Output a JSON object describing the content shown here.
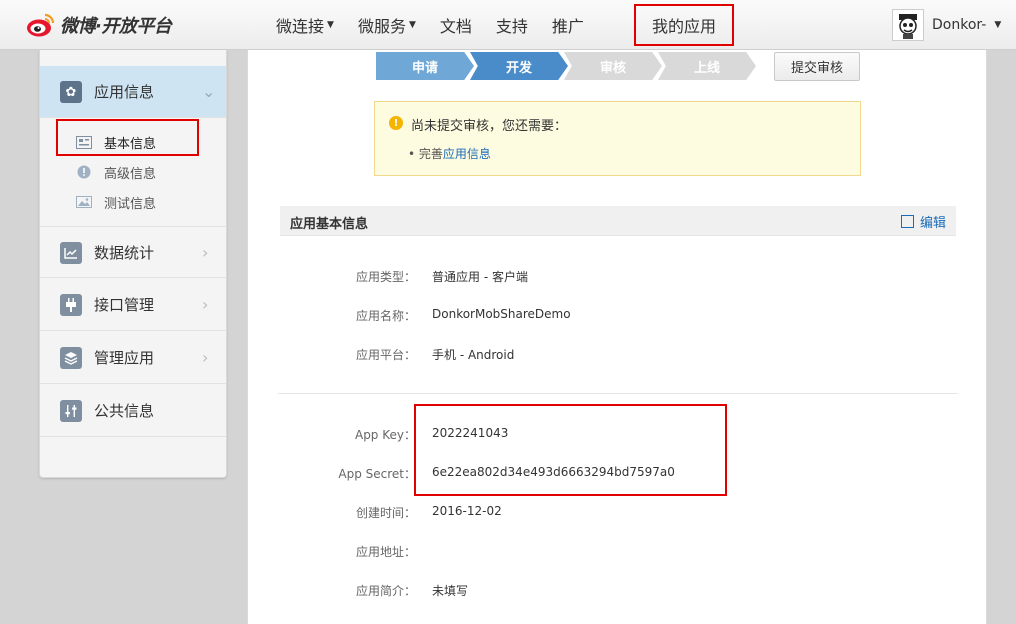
{
  "header": {
    "logo_text": "微博·开放平台",
    "nav": [
      {
        "label": "微连接",
        "caret": true
      },
      {
        "label": "微服务",
        "caret": true
      },
      {
        "label": "文档",
        "caret": false
      },
      {
        "label": "支持",
        "caret": false
      },
      {
        "label": "推广",
        "caret": false
      }
    ],
    "my_apps": "我的应用",
    "user_name": "Donkor-"
  },
  "sidebar": {
    "groups": [
      {
        "label": "应用信息",
        "icon": "gear-icon",
        "active": true
      },
      {
        "label": "数据统计",
        "icon": "chart-icon"
      },
      {
        "label": "接口管理",
        "icon": "plug-icon"
      },
      {
        "label": "管理应用",
        "icon": "layers-icon"
      },
      {
        "label": "公共信息",
        "icon": "sliders-icon"
      }
    ],
    "sub_items": [
      {
        "label": "基本信息",
        "icon": "card-icon",
        "current": true
      },
      {
        "label": "高级信息",
        "icon": "alert-icon"
      },
      {
        "label": "测试信息",
        "icon": "image-icon"
      }
    ]
  },
  "steps": [
    {
      "label": "申请",
      "state": "done"
    },
    {
      "label": "开发",
      "state": "current"
    },
    {
      "label": "审核",
      "state": "todo"
    },
    {
      "label": "上线",
      "state": "todo"
    }
  ],
  "submit_button": "提交审核",
  "notice": {
    "title": "尚未提交审核，您还需要：",
    "item_prefix": "完善",
    "item_link": "应用信息"
  },
  "section": {
    "title": "应用基本信息",
    "edit": "编辑"
  },
  "fields": [
    {
      "key": "应用类型：",
      "value": "普通应用 - 客户端"
    },
    {
      "key": "应用名称：",
      "value": "DonkorMobShareDemo"
    },
    {
      "key": "应用平台：",
      "value": "手机 - Android"
    },
    {
      "key": "App Key：",
      "value": "2022241043"
    },
    {
      "key": "App Secret：",
      "value": "6e22ea802d34e493d6663294bd7597a0"
    },
    {
      "key": "创建时间：",
      "value": "2016-12-02"
    },
    {
      "key": "应用地址：",
      "value": ""
    },
    {
      "key": "应用简介：",
      "value": "未填写"
    }
  ],
  "colors": {
    "accent": "#4a8cc9",
    "highlight_border": "#e00000",
    "link": "#1a6cb8",
    "notice_bg": "#fdfbe0"
  }
}
